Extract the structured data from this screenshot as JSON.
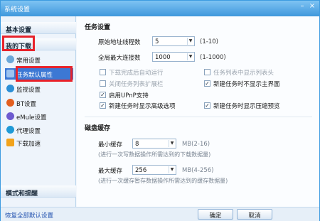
{
  "window": {
    "title": "系统设置"
  },
  "sidebar": {
    "basic": "基本设置",
    "downloads": "我的下载",
    "items": [
      {
        "label": "常用设置",
        "icon": "gear-icon",
        "color": "#6aa7d8"
      },
      {
        "label": "任务默认属性",
        "icon": "task-icon",
        "color": "#3a6fc4"
      },
      {
        "label": "监视设置",
        "icon": "monitor-icon",
        "color": "#2b8fd6"
      },
      {
        "label": "BT设置",
        "icon": "bt-icon",
        "color": "#e35f1f"
      },
      {
        "label": "eMule设置",
        "icon": "emule-icon",
        "color": "#6d5bd0"
      },
      {
        "label": "代理设置",
        "icon": "proxy-icon",
        "color": "#1f9ad6"
      },
      {
        "label": "下载加速",
        "icon": "accelerate-icon",
        "color": "#f2a31c"
      }
    ],
    "mode": "模式和提醒"
  },
  "footer": {
    "link": "恢复全部默认设置",
    "ok": "确定",
    "cancel": "取消"
  },
  "task": {
    "heading": "任务设置",
    "threads_label": "原始地址线程数",
    "threads_value": "5",
    "threads_hint": "(1-10)",
    "connections_label": "全局最大连接数",
    "connections_value": "1000",
    "connections_hint": "(1-1000)",
    "options": [
      {
        "label": "下载完成后自动运行",
        "checked": false,
        "enabled": false
      },
      {
        "label": "任务列表中显示列表头",
        "checked": false,
        "enabled": false
      },
      {
        "label": "关闭任务列表扩展栏",
        "checked": false,
        "enabled": false
      },
      {
        "label": "新建任务时不显示主界面",
        "checked": true,
        "enabled": true
      },
      {
        "label": "启用UPnP支持",
        "checked": true,
        "enabled": true
      },
      {
        "label": "新建任务时显示高级选项",
        "checked": true,
        "enabled": true
      },
      {
        "label": "新建任务时显示压缩预览",
        "checked": true,
        "enabled": true
      }
    ]
  },
  "cache": {
    "heading": "磁盘缓存",
    "min_label": "最小缓存",
    "min_value": "8",
    "min_hint": "MB(2-16)",
    "min_desc": "(进行一次写数据操作所需达到的下载数据量)",
    "max_label": "最大缓存",
    "max_value": "256",
    "max_hint": "MB(4-256)",
    "max_desc": "(进行一次缓存暂存数据操作所需达到的缓存数据量)"
  },
  "colors": {
    "highlight": "#e8222a",
    "selected": "#3c78d4",
    "titlebar": "#3f98dc"
  }
}
